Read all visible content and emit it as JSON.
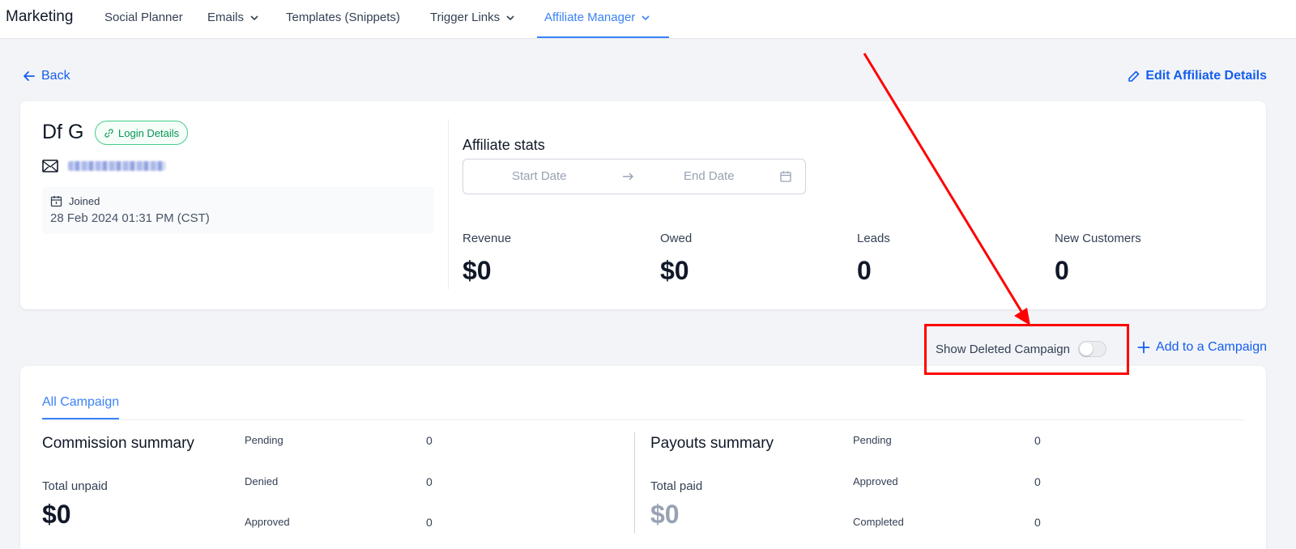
{
  "nav": {
    "brand": "Marketing",
    "items": [
      {
        "label": "Social Planner",
        "dropdown": false
      },
      {
        "label": "Emails",
        "dropdown": true
      },
      {
        "label": "Templates (Snippets)",
        "dropdown": false
      },
      {
        "label": "Trigger Links",
        "dropdown": true
      },
      {
        "label": "Affiliate Manager",
        "dropdown": true,
        "active": true
      }
    ]
  },
  "actions": {
    "back_label": "Back",
    "edit_label": "Edit Affiliate Details"
  },
  "affiliate": {
    "name": "Df G",
    "login_badge": "Login Details",
    "joined_label": "Joined",
    "joined_date": "28 Feb 2024 01:31 PM (CST)"
  },
  "stats": {
    "title": "Affiliate stats",
    "start_placeholder": "Start Date",
    "end_placeholder": "End Date",
    "items": [
      {
        "label": "Revenue",
        "value": "$0"
      },
      {
        "label": "Owed",
        "value": "$0"
      },
      {
        "label": "Leads",
        "value": "0"
      },
      {
        "label": "New Customers",
        "value": "0"
      }
    ]
  },
  "campaign_controls": {
    "toggle_label": "Show Deleted Campaign",
    "toggle_on": false,
    "add_label": "Add to a Campaign"
  },
  "campaigns": {
    "tab_label": "All Campaign",
    "commission": {
      "title": "Commission summary",
      "total_label": "Total unpaid",
      "total_value": "$0",
      "rows": [
        {
          "label": "Pending",
          "value": "0"
        },
        {
          "label": "Denied",
          "value": "0"
        },
        {
          "label": "Approved",
          "value": "0"
        }
      ]
    },
    "payouts": {
      "title": "Payouts summary",
      "total_label": "Total paid",
      "total_value": "$0",
      "rows": [
        {
          "label": "Pending",
          "value": "0"
        },
        {
          "label": "Approved",
          "value": "0"
        },
        {
          "label": "Completed",
          "value": "0"
        }
      ]
    }
  },
  "colors": {
    "accent": "#155eef",
    "active_tab": "#3b82f6",
    "annotation": "#ff0000",
    "badge_green": "#079455"
  }
}
